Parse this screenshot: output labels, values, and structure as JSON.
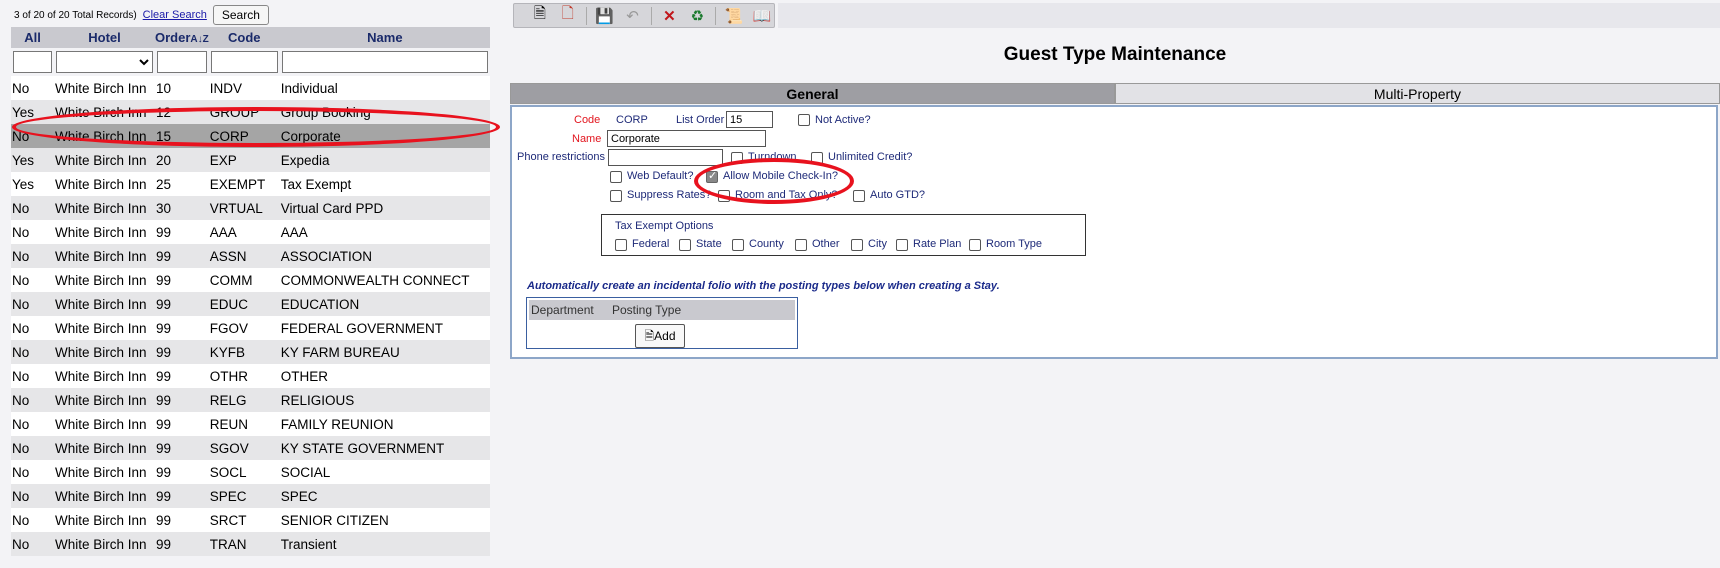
{
  "list": {
    "records_info": "3 of 20 of 20 Total Records)",
    "clear_search": "Clear Search",
    "search_label": "Search",
    "columns": [
      "All",
      "Hotel",
      "Order",
      "Code",
      "Name"
    ],
    "sort_icon": "A↓Z",
    "rows": [
      [
        "No",
        "White Birch Inn",
        "10",
        "INDV",
        "Individual"
      ],
      [
        "Yes",
        "White Birch Inn",
        "12",
        "GROUP",
        "Group Booking"
      ],
      [
        "No",
        "White Birch Inn",
        "15",
        "CORP",
        "Corporate"
      ],
      [
        "Yes",
        "White Birch Inn",
        "20",
        "EXP",
        "Expedia"
      ],
      [
        "Yes",
        "White Birch Inn",
        "25",
        "EXEMPT",
        "Tax Exempt"
      ],
      [
        "No",
        "White Birch Inn",
        "30",
        "VRTUAL",
        "Virtual Card PPD"
      ],
      [
        "No",
        "White Birch Inn",
        "99",
        "AAA",
        "AAA"
      ],
      [
        "No",
        "White Birch Inn",
        "99",
        "ASSN",
        "ASSOCIATION"
      ],
      [
        "No",
        "White Birch Inn",
        "99",
        "COMM",
        "COMMONWEALTH CONNECT"
      ],
      [
        "No",
        "White Birch Inn",
        "99",
        "EDUC",
        "EDUCATION"
      ],
      [
        "No",
        "White Birch Inn",
        "99",
        "FGOV",
        "FEDERAL GOVERNMENT"
      ],
      [
        "No",
        "White Birch Inn",
        "99",
        "KYFB",
        "KY FARM BUREAU"
      ],
      [
        "No",
        "White Birch Inn",
        "99",
        "OTHR",
        "OTHER"
      ],
      [
        "No",
        "White Birch Inn",
        "99",
        "RELG",
        "RELIGIOUS"
      ],
      [
        "No",
        "White Birch Inn",
        "99",
        "REUN",
        "FAMILY REUNION"
      ],
      [
        "No",
        "White Birch Inn",
        "99",
        "SGOV",
        "KY STATE GOVERNMENT"
      ],
      [
        "No",
        "White Birch Inn",
        "99",
        "SOCL",
        "SOCIAL"
      ],
      [
        "No",
        "White Birch Inn",
        "99",
        "SPEC",
        "SPEC"
      ],
      [
        "No",
        "White Birch Inn",
        "99",
        "SRCT",
        "SENIOR CITIZEN"
      ],
      [
        "No",
        "White Birch Inn",
        "99",
        "TRAN",
        "Transient"
      ]
    ],
    "selected_index": 2
  },
  "toolbar": {
    "icons": [
      "new-document-icon",
      "copy-document-icon",
      "save-icon",
      "undo-icon",
      "delete-icon",
      "refresh-icon",
      "report-icon",
      "help-book-icon"
    ]
  },
  "form": {
    "title": "Guest Type Maintenance",
    "tabs": [
      "General",
      "Multi-Property"
    ],
    "code_label": "Code",
    "code_value": "CORP",
    "list_order_label": "List Order",
    "list_order_value": "15",
    "not_active_label": "Not Active?",
    "name_label": "Name",
    "name_value": "Corporate",
    "phone_label": "Phone restrictions",
    "phone_value": "",
    "turndown_label": "Turndown",
    "unlimited_credit_label": "Unlimited Credit?",
    "web_default_label": "Web Default?",
    "mobile_checkin_label": "Allow Mobile Check-In?",
    "mobile_checkin_checked": true,
    "suppress_rates_label": "Suppress Rates?",
    "room_tax_only_label": "Room and Tax Only?",
    "auto_gtd_label": "Auto GTD?",
    "tax_exempt_title": "Tax Exempt Options",
    "tax_options": [
      "Federal",
      "State",
      "County",
      "Other",
      "City",
      "Rate Plan",
      "Room Type"
    ],
    "auto_folio_text": "Automatically create an incidental folio with the posting types below when creating a Stay.",
    "dept_col": "Department",
    "posting_col": "Posting Type",
    "add_label": "Add"
  },
  "colors": {
    "highlight_oval": "#e8121e",
    "required_label": "#e2161f",
    "label_blue": "#1e2a78"
  }
}
